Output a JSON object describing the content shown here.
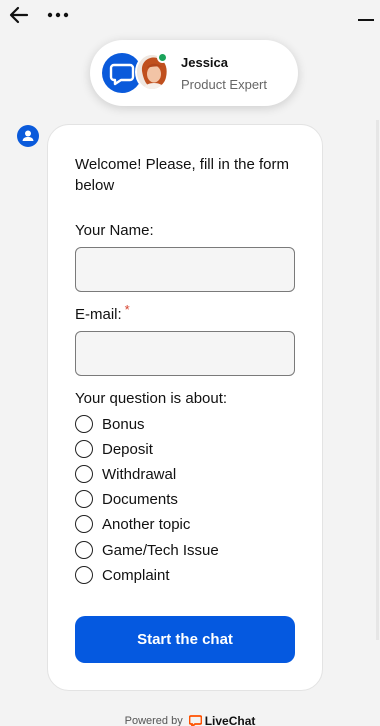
{
  "agent": {
    "name": "Jessica",
    "role": "Product Expert"
  },
  "form": {
    "welcome": "Welcome! Please, fill in the form below",
    "name_label": "Your Name:",
    "name_value": "",
    "email_label": "E-mail:",
    "required_mark": "*",
    "email_value": "",
    "question_label": "Your question is about:",
    "options": [
      "Bonus",
      "Deposit",
      "Withdrawal",
      "Documents",
      "Another topic",
      "Game/Tech Issue",
      "Complaint"
    ],
    "submit_label": "Start the chat"
  },
  "footer": {
    "powered_by": "Powered by",
    "brand": "LiveChat"
  },
  "colors": {
    "accent": "#0559e0",
    "online": "#1aa35a",
    "required": "#d6402c",
    "brand_logo": "#ff5100"
  },
  "icons": [
    "back-arrow-icon",
    "more-dots-icon",
    "minimize-icon",
    "chat-bubble-icon",
    "user-icon",
    "livechat-logo-icon"
  ]
}
